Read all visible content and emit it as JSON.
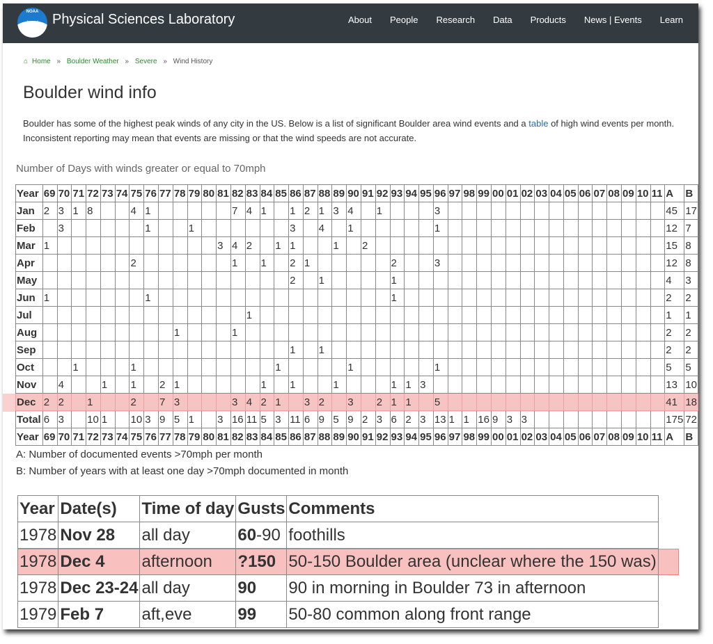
{
  "site": {
    "name": "Physical Sciences Laboratory",
    "logo_text": "NOAA",
    "nav": [
      "About",
      "People",
      "Research",
      "Data",
      "Products",
      "News | Events",
      "Learn"
    ]
  },
  "breadcrumb": {
    "items": [
      "Home",
      "Boulder Weather",
      "Severe",
      "Wind History"
    ],
    "separator": "»"
  },
  "page": {
    "title": "Boulder wind info",
    "intro_before": "Boulder has some of the highest peak winds of any city in the US. Below is a list of significant Boulder area wind events and a ",
    "intro_link": "table",
    "intro_after": " of high wind events per month. Inconsistent reporting may mean that events are missing or that the wind speeds are not accurate."
  },
  "wind_table": {
    "caption": "Number of Days with winds greater or equal to 70mph",
    "header_label": "Year",
    "years": [
      "69",
      "70",
      "71",
      "72",
      "73",
      "74",
      "75",
      "76",
      "77",
      "78",
      "79",
      "80",
      "81",
      "82",
      "83",
      "84",
      "85",
      "86",
      "87",
      "88",
      "89",
      "90",
      "91",
      "92",
      "93",
      "94",
      "95",
      "96",
      "97",
      "98",
      "99",
      "00",
      "01",
      "02",
      "03",
      "04",
      "05",
      "06",
      "07",
      "08",
      "09",
      "10",
      "11"
    ],
    "col_a": "A",
    "col_b": "B",
    "rows": [
      {
        "label": "Jan",
        "cells": [
          "2",
          "3",
          "1",
          "8",
          "",
          "",
          "4",
          "1",
          "",
          "",
          "",
          "",
          "",
          "7",
          "4",
          "1",
          "",
          "1",
          "2",
          "1",
          "3",
          "4",
          "",
          "1",
          "",
          "",
          "",
          "3",
          "",
          "",
          "",
          "",
          "",
          "",
          "",
          "",
          "",
          "",
          "",
          "",
          "",
          "",
          ""
        ],
        "a": "45",
        "b": "17"
      },
      {
        "label": "Feb",
        "cells": [
          "",
          "3",
          "",
          "",
          "",
          "",
          "",
          "1",
          "",
          "",
          "1",
          "",
          "",
          "",
          "",
          "",
          "",
          "3",
          "",
          "4",
          "",
          "1",
          "",
          "",
          "",
          "",
          "",
          "1",
          "",
          "",
          "",
          "",
          "",
          "",
          "",
          "",
          "",
          "",
          "",
          "",
          "",
          "",
          ""
        ],
        "a": "12",
        "b": "7"
      },
      {
        "label": "Mar",
        "cells": [
          "1",
          "",
          "",
          "",
          "",
          "",
          "",
          "",
          "",
          "",
          "",
          "",
          "3",
          "4",
          "2",
          "",
          "1",
          "1",
          "",
          "",
          "1",
          "",
          "2",
          "",
          "",
          "",
          "",
          "",
          "",
          "",
          "",
          "",
          "",
          "",
          "",
          "",
          "",
          "",
          "",
          "",
          "",
          "",
          ""
        ],
        "a": "15",
        "b": "8"
      },
      {
        "label": "Apr",
        "cells": [
          "",
          "",
          "",
          "",
          "",
          "",
          "2",
          "",
          "",
          "",
          "",
          "",
          "",
          "1",
          "",
          "1",
          "",
          "2",
          "1",
          "",
          "",
          "",
          "",
          "",
          "2",
          "",
          "",
          "3",
          "",
          "",
          "",
          "",
          "",
          "",
          "",
          "",
          "",
          "",
          "",
          "",
          "",
          "",
          ""
        ],
        "a": "12",
        "b": "8"
      },
      {
        "label": "May",
        "cells": [
          "",
          "",
          "",
          "",
          "",
          "",
          "",
          "",
          "",
          "",
          "",
          "",
          "",
          "",
          "",
          "",
          "",
          "2",
          "",
          "1",
          "",
          "",
          "",
          "",
          "1",
          "",
          "",
          "",
          "",
          "",
          "",
          "",
          "",
          "",
          "",
          "",
          "",
          "",
          "",
          "",
          "",
          "",
          ""
        ],
        "a": "4",
        "b": "3"
      },
      {
        "label": "Jun",
        "cells": [
          "1",
          "",
          "",
          "",
          "",
          "",
          "",
          "1",
          "",
          "",
          "",
          "",
          "",
          "",
          "",
          "",
          "",
          "",
          "",
          "",
          "",
          "",
          "",
          "",
          "1",
          "",
          "",
          "",
          "",
          "",
          "",
          "",
          "",
          "",
          "",
          "",
          "",
          "",
          "",
          "",
          "",
          "",
          ""
        ],
        "a": "2",
        "b": "2"
      },
      {
        "label": "Jul",
        "cells": [
          "",
          "",
          "",
          "",
          "",
          "",
          "",
          "",
          "",
          "",
          "",
          "",
          "",
          "",
          "1",
          "",
          "",
          "",
          "",
          "",
          "",
          "",
          "",
          "",
          "",
          "",
          "",
          "",
          "",
          "",
          "",
          "",
          "",
          "",
          "",
          "",
          "",
          "",
          "",
          "",
          "",
          "",
          ""
        ],
        "a": "1",
        "b": "1"
      },
      {
        "label": "Aug",
        "cells": [
          "",
          "",
          "",
          "",
          "",
          "",
          "",
          "",
          "",
          "1",
          "",
          "",
          "",
          "1",
          "",
          "",
          "",
          "",
          "",
          "",
          "",
          "",
          "",
          "",
          "",
          "",
          "",
          "",
          "",
          "",
          "",
          "",
          "",
          "",
          "",
          "",
          "",
          "",
          "",
          "",
          "",
          "",
          ""
        ],
        "a": "2",
        "b": "2"
      },
      {
        "label": "Sep",
        "cells": [
          "",
          "",
          "",
          "",
          "",
          "",
          "",
          "",
          "",
          "",
          "",
          "",
          "",
          "",
          "",
          "",
          "",
          "1",
          "",
          "1",
          "",
          "",
          "",
          "",
          "",
          "",
          "",
          "",
          "",
          "",
          "",
          "",
          "",
          "",
          "",
          "",
          "",
          "",
          "",
          "",
          "",
          "",
          ""
        ],
        "a": "2",
        "b": "2"
      },
      {
        "label": "Oct",
        "cells": [
          "",
          "",
          "1",
          "",
          "",
          "",
          "1",
          "",
          "",
          "",
          "",
          "",
          "",
          "",
          "",
          "",
          "1",
          "",
          "",
          "",
          "",
          "1",
          "",
          "",
          "",
          "",
          "",
          "1",
          "",
          "",
          "",
          "",
          "",
          "",
          "",
          "",
          "",
          "",
          "",
          "",
          "",
          "",
          ""
        ],
        "a": "5",
        "b": "5"
      },
      {
        "label": "Nov",
        "cells": [
          "",
          "4",
          "",
          "",
          "1",
          "",
          "1",
          "",
          "2",
          "1",
          "",
          "",
          "",
          "",
          "",
          "1",
          "",
          "1",
          "",
          "",
          "1",
          "",
          "",
          "",
          "1",
          "1",
          "3",
          "",
          "",
          "",
          "",
          "",
          "",
          "",
          "",
          "",
          "",
          "",
          "",
          "",
          "",
          "",
          ""
        ],
        "a": "13",
        "b": "10"
      },
      {
        "label": "Dec",
        "cells": [
          "2",
          "2",
          "",
          "1",
          "",
          "",
          "2",
          "",
          "7",
          "3",
          "",
          "",
          "",
          "3",
          "4",
          "2",
          "1",
          "",
          "3",
          "2",
          "",
          "3",
          "",
          "2",
          "1",
          "1",
          "",
          "5",
          "",
          "",
          "",
          "",
          "",
          "",
          "",
          "",
          "",
          "",
          "",
          "",
          "",
          "",
          ""
        ],
        "a": "41",
        "b": "18"
      },
      {
        "label": "Total",
        "cells": [
          "6",
          "3",
          "",
          "10",
          "1",
          "",
          "10",
          "3",
          "9",
          "5",
          "1",
          "",
          "3",
          "16",
          "11",
          "5",
          "3",
          "11",
          "6",
          "9",
          "5",
          "9",
          "2",
          "3",
          "6",
          "2",
          "3",
          "13",
          "1",
          "1",
          "16",
          "9",
          "3",
          "3",
          "",
          "",
          "",
          "",
          "",
          "",
          "",
          "",
          ""
        ],
        "a": "175",
        "b": "72"
      }
    ],
    "highlight_row": "Dec"
  },
  "notes": {
    "a": "A: Number of documented events >70mph per month",
    "b": "B: Number of years with at least one day >70mph documented in month"
  },
  "events_table": {
    "headers": [
      "Year",
      "Date(s)",
      "Time of day",
      "Gusts",
      "Comments"
    ],
    "rows": [
      {
        "year": "1978",
        "date": "Nov 28",
        "time": "all day",
        "gust_bold": "60",
        "gust_rest": "-90",
        "comment": "foothills"
      },
      {
        "year": "1978",
        "date": "Dec 4",
        "time": "afternoon",
        "gust_bold": "?150",
        "gust_rest": "",
        "comment": "50-150 Boulder area (unclear where the 150 was)"
      },
      {
        "year": "1978",
        "date": "Dec 23-24",
        "time": "all day",
        "gust_bold": "90",
        "gust_rest": "",
        "comment": "90 in morning in Boulder 73 in afternoon"
      },
      {
        "year": "1979",
        "date": "Feb 7",
        "time": "aft,eve",
        "gust_bold": "99",
        "gust_rest": "",
        "comment": "50-80 common along front range"
      }
    ],
    "highlight_row_index": 1
  },
  "colors": {
    "navbar": "#333a40",
    "breadcrumb_link": "#2a8a2a",
    "link": "#2b6cb0",
    "highlight": "#f7c4c4"
  }
}
